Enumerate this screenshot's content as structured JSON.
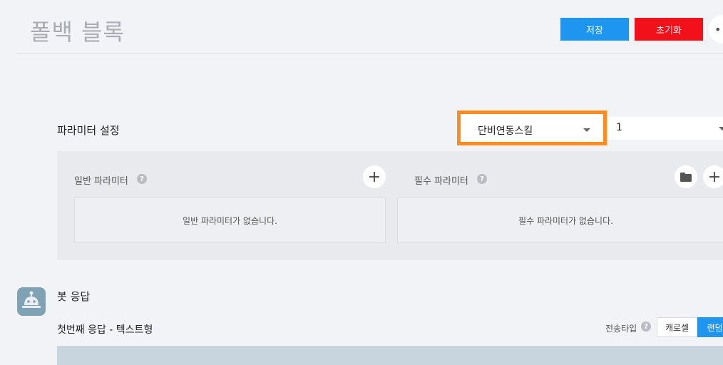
{
  "header": {
    "title": "폴백 블록",
    "save_label": "저장",
    "reset_label": "초기화",
    "more_label": "••"
  },
  "params": {
    "section_label": "파라미터 설정",
    "skill_select_value": "단비연동스킬",
    "number_select_value": "1",
    "general": {
      "label": "일반 파라미터",
      "empty_text": "일반 파라미터가 없습니다."
    },
    "required": {
      "label": "필수 파라미터",
      "empty_text": "필수 파라미터가 없습니다."
    },
    "help_glyph": "?",
    "add_glyph": "+"
  },
  "bot": {
    "title": "봇 응답",
    "response_title": "첫번째 응답 - 텍스트형",
    "send_type_label": "전송타입",
    "send_types": [
      "캐로셀",
      "랜덤형"
    ]
  },
  "colors": {
    "accent": "#1e96f0",
    "danger": "#f2101a",
    "highlight": "#ff8a1e"
  },
  "icons": [
    "more-icon",
    "help-icon",
    "plus-icon",
    "folder-icon",
    "chevron-down-icon",
    "bot-icon"
  ]
}
